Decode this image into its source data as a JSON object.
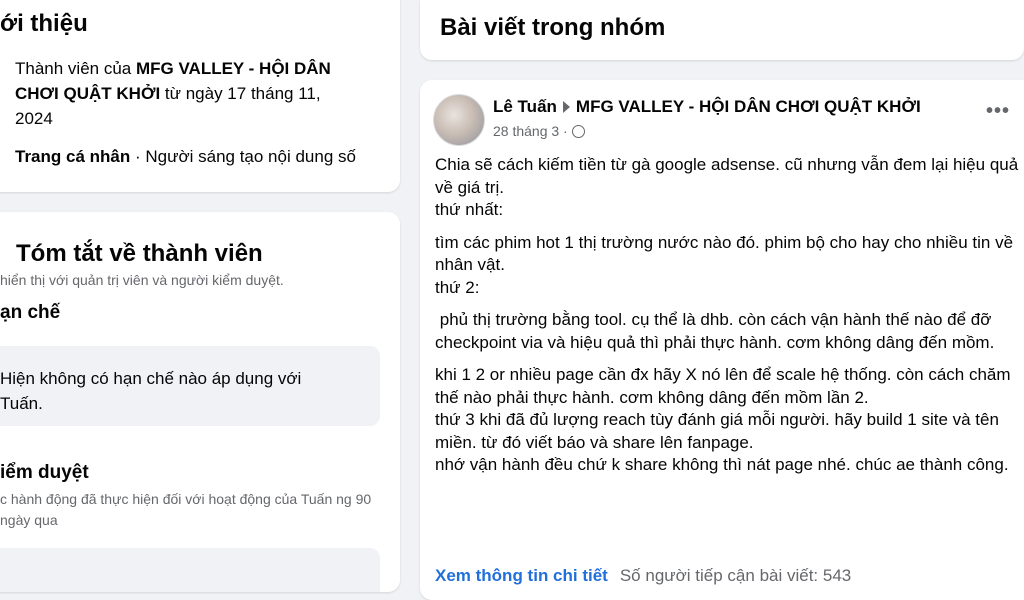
{
  "intro": {
    "title": "ới thiệu",
    "member_prefix": "Thành viên của ",
    "group_name": "MFG VALLEY - HỘI DÂN CHƠI QUẬT KHỞI",
    "member_suffix": " từ ngày 17 tháng 11, 2024",
    "profile_label": "Trang cá nhân",
    "profile_detail": " · Người sáng tạo nội dung số"
  },
  "summary": {
    "title": "Tóm tắt về thành viên",
    "subtitle": "hiển thị với quản trị viên và người kiểm duyệt.",
    "restrict_heading": "ạn chế",
    "restrict_text": "Hiện không có hạn chế nào áp dụng với Tuấn.",
    "review_heading": "iểm duyệt",
    "review_text": "c hành động đã thực hiện đối với hoạt động của Tuấn ng 90 ngày qua"
  },
  "posts_header": {
    "title": "Bài viết trong nhóm"
  },
  "post": {
    "author": "Lê Tuấn",
    "group": "MFG VALLEY - HỘI DÂN CHƠI QUẬT KHỞI",
    "date": "28 tháng 3 ·",
    "more_icon": "more-horizontal-icon",
    "globe_icon": "globe-icon",
    "body": {
      "p1": "Chia sẽ cách kiếm tiền từ gà google adsense. cũ nhưng vẫn đem lại hiệu quả về giá trị.",
      "p1b": "thứ nhất:",
      "p2": "tìm các phim hot 1 thị trường nước nào đó. phim bộ cho hay cho nhiều tin về nhân vật.",
      "p2b": "thứ 2:",
      "p3": " phủ thị trường bằng tool. cụ thể là dhb. còn cách vận hành thế nào để đỡ checkpoint via và hiệu quả thì phải thực hành. cơm không dâng đến mồm.",
      "p4": "khi 1 2 or nhiều page cần đx hãy X nó lên để scale hệ thống. còn cách chăm thế nào phải thực hành. cơm không dâng đến mồm lần 2.",
      "p5": "thứ 3 khi đã đủ lượng reach tùy đánh giá mỗi người. hãy build 1 site và tên miền. từ đó viết báo và share lên fanpage.",
      "p6": "nhớ vận hành đều chứ k share không thì nát page nhé. chúc ae thành công."
    },
    "footer_link": "Xem thông tin chi tiết",
    "footer_rest": "Số người tiếp cận bài viết: 543"
  },
  "colors": {
    "link": "#216fdb",
    "secondary_text": "#65676b",
    "background": "#f0f2f5"
  }
}
